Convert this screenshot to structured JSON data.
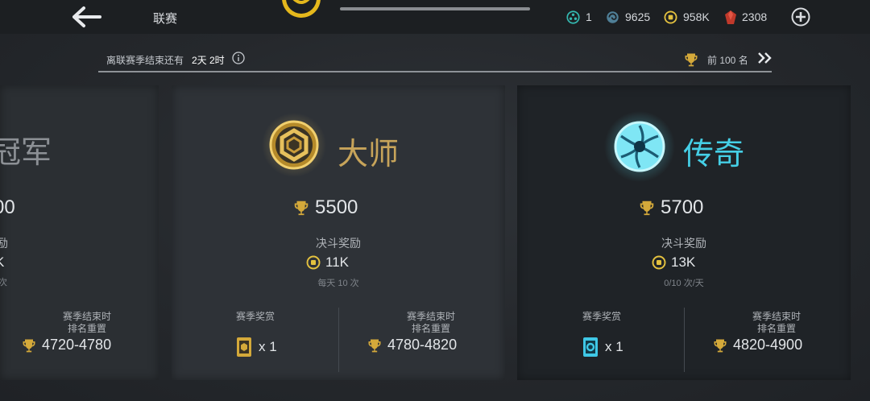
{
  "header": {
    "title": "联赛",
    "resources": [
      {
        "icon": "teal-token-icon",
        "value": "1"
      },
      {
        "icon": "swirl-currency-icon",
        "value": "9625"
      },
      {
        "icon": "gold-coin-icon",
        "value": "958K"
      },
      {
        "icon": "red-gem-icon",
        "value": "2308"
      }
    ]
  },
  "season": {
    "remaining_label": "离联赛季结束还有",
    "remaining_time": "2天 2时",
    "rank_label": "前 100 名"
  },
  "leagues": {
    "champion": {
      "name": "冠军",
      "score": "00",
      "coins": "K",
      "daily": "次",
      "reset_label_1": "赛季结束时",
      "reset_label_2": "排名重置",
      "reset_range": "4720-4780"
    },
    "master": {
      "name": "大师",
      "score": "5500",
      "duel_reward_label": "决斗奖励",
      "coins": "11K",
      "daily": "每天 10 次",
      "season_reward_label": "赛季奖赏",
      "season_reward_count": "x 1",
      "reset_label_1": "赛季结束时",
      "reset_label_2": "排名重置",
      "reset_range": "4780-4820"
    },
    "legend": {
      "name": "传奇",
      "score": "5700",
      "duel_reward_label": "决斗奖励",
      "coins": "13K",
      "daily": "0/10 次/天",
      "season_reward_label": "赛季奖赏",
      "season_reward_count": "x 1",
      "reset_label_1": "赛季结束时",
      "reset_label_2": "排名重置",
      "reset_range": "4820-4900"
    }
  },
  "colors": {
    "gold": "#d4a93a",
    "cyan": "#3fd6ee",
    "text": "#e2e5e8"
  }
}
